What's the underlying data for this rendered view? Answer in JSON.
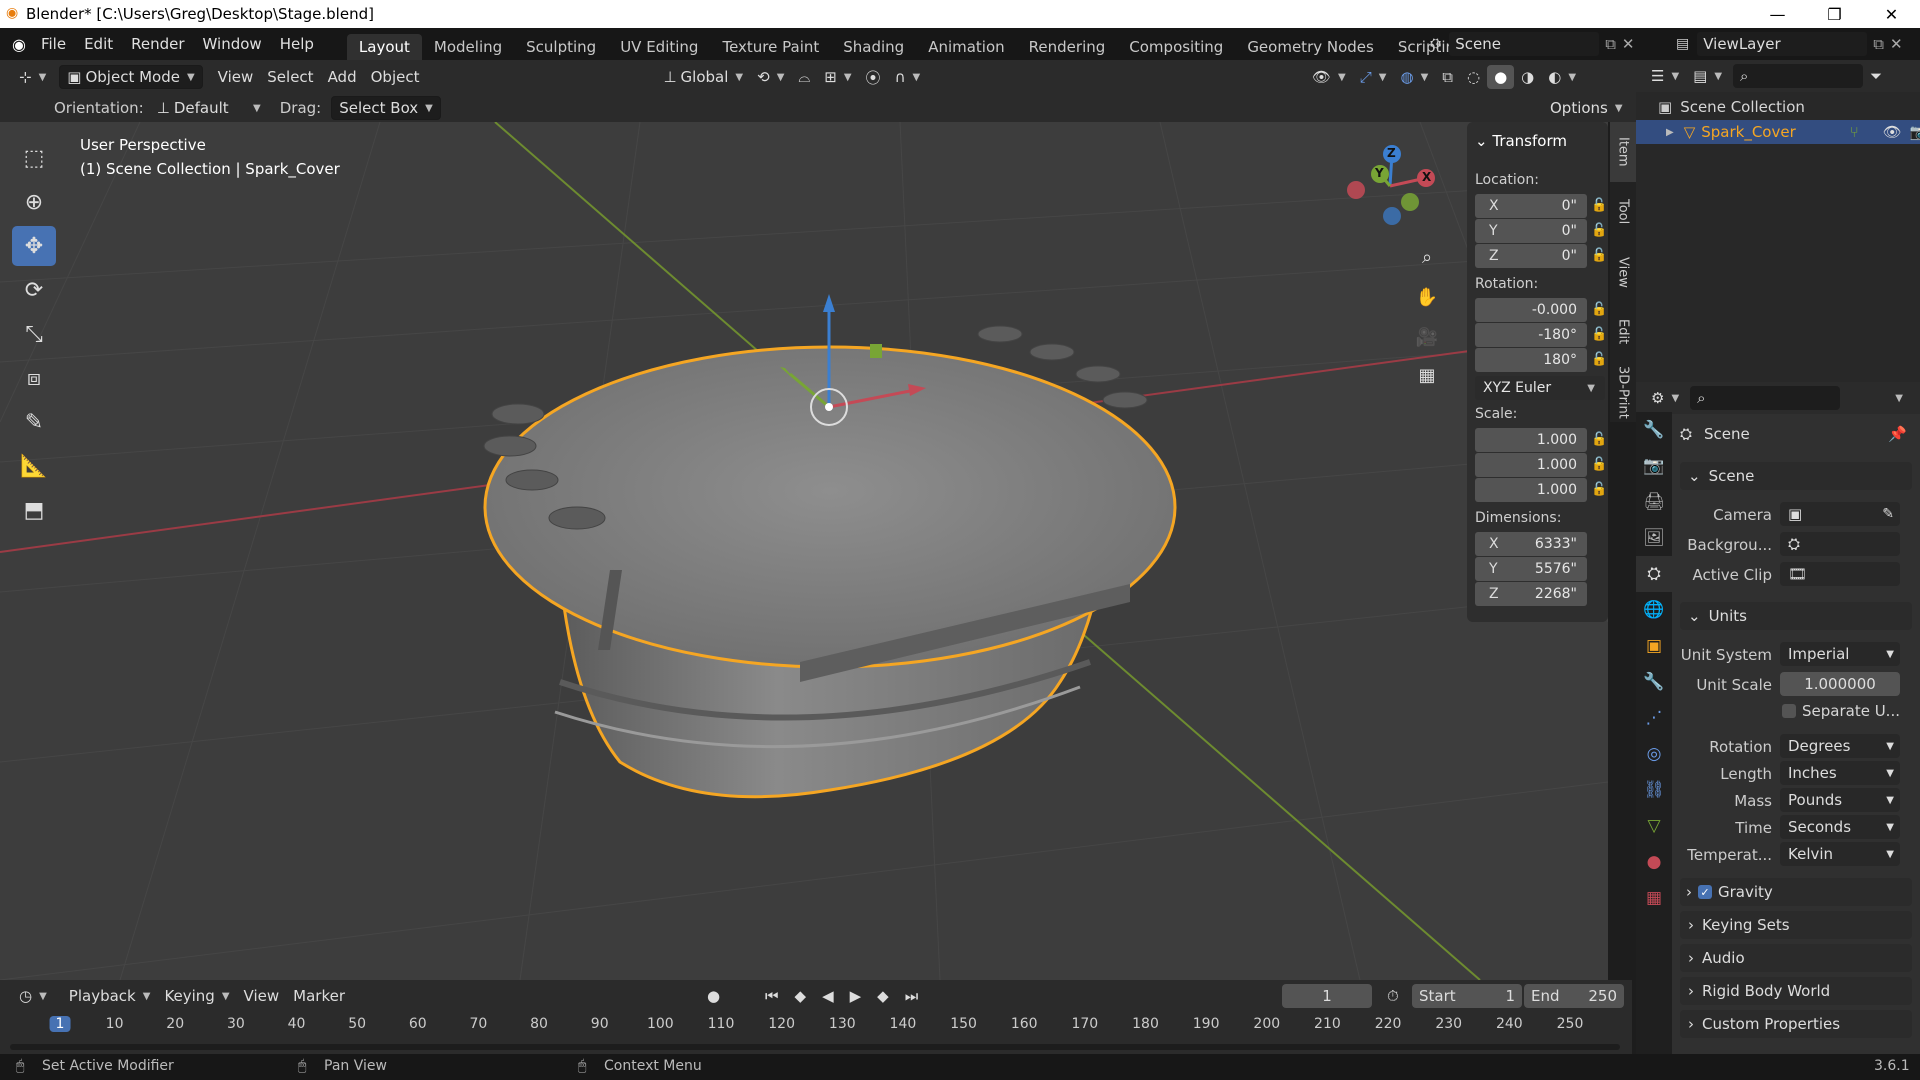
{
  "window": {
    "title": "Blender* [C:\\Users\\Greg\\Desktop\\Stage.blend]",
    "min": "—",
    "max": "❐",
    "close": "✕"
  },
  "menu": [
    "File",
    "Edit",
    "Render",
    "Window",
    "Help"
  ],
  "workspaces": [
    "Layout",
    "Modeling",
    "Sculpting",
    "UV Editing",
    "Texture Paint",
    "Shading",
    "Animation",
    "Rendering",
    "Compositing",
    "Geometry Nodes",
    "Scripting"
  ],
  "workspace_add": "+",
  "scene_name": "Scene",
  "view_layer": "ViewLayer",
  "viewport_header": {
    "mode": "Object Mode",
    "menus": [
      "View",
      "Select",
      "Add",
      "Object"
    ],
    "transform_orientation": "Global",
    "options": "Options"
  },
  "tool_settings": {
    "orientation_label": "Orientation:",
    "orientation_value": "Default",
    "drag_label": "Drag:",
    "drag_value": "Select Box"
  },
  "viewport_overlay_text": {
    "line1": "User Perspective",
    "line2": "(1) Scene Collection | Spark_Cover"
  },
  "gizmo_axes": {
    "x": "X",
    "y": "Y",
    "z": "Z"
  },
  "npanel": {
    "title": "Transform",
    "location_label": "Location:",
    "location": [
      {
        "axis": "X",
        "value": "0\""
      },
      {
        "axis": "Y",
        "value": "0\""
      },
      {
        "axis": "Z",
        "value": "0\""
      }
    ],
    "rotation_label": "Rotation:",
    "rotation": [
      "-0.000",
      "-180°",
      "180°"
    ],
    "rotation_mode": "XYZ Euler",
    "scale_label": "Scale:",
    "scale": [
      "1.000",
      "1.000",
      "1.000"
    ],
    "dimensions_label": "Dimensions:",
    "dimensions": [
      {
        "axis": "X",
        "value": "6333\""
      },
      {
        "axis": "Y",
        "value": "5576\""
      },
      {
        "axis": "Z",
        "value": "2268\""
      }
    ],
    "tabs": [
      "Item",
      "Tool",
      "View",
      "Edit",
      "3D-Print"
    ]
  },
  "outliner": {
    "root": "Scene Collection",
    "items": [
      {
        "name": "Spark_Cover"
      }
    ]
  },
  "properties": {
    "context": "Scene",
    "scene_panel": "Scene",
    "camera_label": "Camera",
    "background_label": "Backgrou...",
    "active_clip_label": "Active Clip",
    "units_panel": "Units",
    "unit_system_label": "Unit System",
    "unit_system": "Imperial",
    "unit_scale_label": "Unit Scale",
    "unit_scale": "1.000000",
    "separate_units": "Separate U...",
    "rotation_label": "Rotation",
    "rotation": "Degrees",
    "length_label": "Length",
    "length": "Inches",
    "mass_label": "Mass",
    "mass": "Pounds",
    "time_label": "Time",
    "time": "Seconds",
    "temperature_label": "Temperat...",
    "temperature": "Kelvin",
    "gravity": "Gravity",
    "collapsed": [
      "Keying Sets",
      "Audio",
      "Rigid Body World",
      "Custom Properties"
    ]
  },
  "timeline": {
    "menus": [
      "Playback",
      "Keying",
      "View",
      "Marker"
    ],
    "current_frame": "1",
    "start_label": "Start",
    "start": "1",
    "end_label": "End",
    "end": "250",
    "ticks": [
      "1",
      "10",
      "20",
      "30",
      "40",
      "50",
      "60",
      "70",
      "80",
      "90",
      "100",
      "110",
      "120",
      "130",
      "140",
      "150",
      "160",
      "170",
      "180",
      "190",
      "200",
      "210",
      "220",
      "230",
      "240",
      "250"
    ]
  },
  "statusbar": {
    "left": "Set Active Modifier",
    "middle": "Pan View",
    "right": "Context Menu",
    "version": "3.6.1"
  },
  "colors": {
    "accent": "#4772b3",
    "selection_outline": "#f5a623",
    "x_axis": "#c44a56",
    "y_axis": "#78a535",
    "z_axis": "#3b7fd1"
  }
}
